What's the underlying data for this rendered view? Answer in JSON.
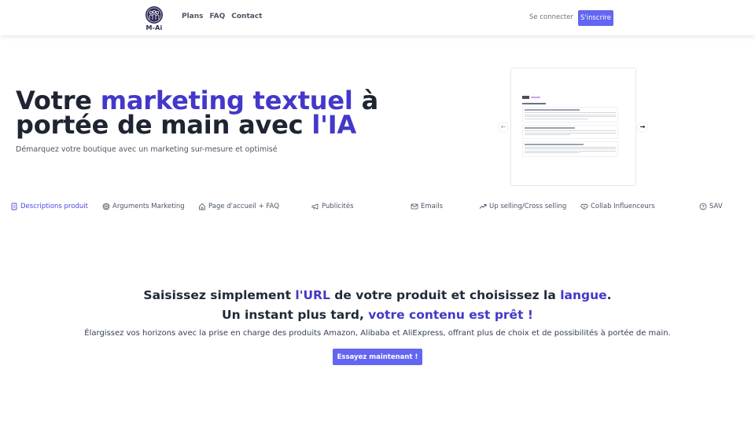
{
  "header": {
    "logo_text": "M-Ai",
    "nav": [
      {
        "label": "Plans"
      },
      {
        "label": "FAQ"
      },
      {
        "label": "Contact"
      }
    ],
    "login_label": "Se connecter",
    "signup_label": "S'inscrire"
  },
  "hero": {
    "title_part1": "Votre ",
    "title_accent1": "marketing textuel",
    "title_part2": " à portée de main avec ",
    "title_accent2": "l'IA",
    "subtitle": "Démarquez votre boutique avec un marketing sur-mesure et optimisé"
  },
  "carousel": {
    "prev_icon": "arrow-left-icon",
    "next_icon": "arrow-right-icon",
    "prev_glyph": "←",
    "next_glyph": "→"
  },
  "tabs": [
    {
      "label": "Descriptions produit",
      "icon": "document-icon",
      "active": true
    },
    {
      "label": "Arguments Marketing",
      "icon": "target-icon",
      "active": false
    },
    {
      "label": "Page d'accueil + FAQ",
      "icon": "home-icon",
      "active": false
    },
    {
      "label": "Publicités",
      "icon": "megaphone-icon",
      "active": false
    },
    {
      "label": "Emails",
      "icon": "mail-icon",
      "active": false
    },
    {
      "label": "Up selling/Cross selling",
      "icon": "trending-up-icon",
      "active": false
    },
    {
      "label": "Collab Influenceurs",
      "icon": "handshake-icon",
      "active": false
    },
    {
      "label": "SAV",
      "icon": "help-circle-icon",
      "active": false
    }
  ],
  "section": {
    "line1_a": "Saisissez simplement ",
    "line1_accent1": "l'URL",
    "line1_b": " de votre produit et choisissez la ",
    "line1_accent2": "langue",
    "line1_c": ".",
    "line2_a": "Un instant plus tard, ",
    "line2_accent": "votre contenu est prêt !",
    "description": "Élargissez vos horizons avec la prise en charge des produits Amazon, Alibaba et AliExpress, offrant plus de choix et de possibilités à portée de main.",
    "cta_label": "Essayez maintenant !"
  },
  "colors": {
    "accent": "#4338ca",
    "button": "#6366f1",
    "text_dark": "#1e2432"
  }
}
